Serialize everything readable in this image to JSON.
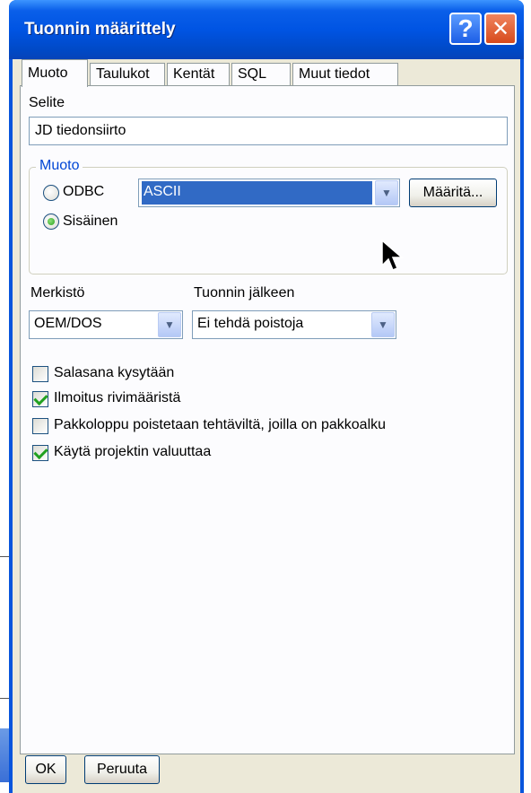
{
  "window": {
    "title": "Tuonnin määrittely",
    "help_label": "?",
    "close_label": "✕"
  },
  "tabs": [
    {
      "label": "Muoto",
      "active": true
    },
    {
      "label": "Taulukot",
      "active": false
    },
    {
      "label": "Kentät",
      "active": false
    },
    {
      "label": "SQL",
      "active": false
    },
    {
      "label": "Muut tiedot",
      "active": false
    }
  ],
  "selite": {
    "label": "Selite",
    "value": "JD tiedonsiirto"
  },
  "muoto_group": {
    "title": "Muoto",
    "radio_odbc": {
      "label": "ODBC",
      "checked": false
    },
    "radio_sisainen": {
      "label": "Sisäinen",
      "checked": true
    },
    "format_combo": {
      "value": "ASCII"
    },
    "define_button": "Määritä..."
  },
  "merkisto": {
    "label": "Merkistö",
    "value": "OEM/DOS"
  },
  "after_import": {
    "label": "Tuonnin jälkeen",
    "value": "Ei tehdä poistoja"
  },
  "checkboxes": [
    {
      "label": "Salasana kysytään",
      "checked": false
    },
    {
      "label": "Ilmoitus rivimääristä",
      "checked": true
    },
    {
      "label": "Pakkoloppu poistetaan tehtäviltä, joilla on pakkoalku",
      "checked": false
    },
    {
      "label": "Käytä projektin valuuttaa",
      "checked": true
    }
  ],
  "buttons": {
    "ok": "OK",
    "cancel": "Peruuta"
  },
  "colors": {
    "titlebar": "#0054e3",
    "dialog_bg": "#ece9d8",
    "selection": "#316ac5",
    "group_title": "#0046d5"
  }
}
